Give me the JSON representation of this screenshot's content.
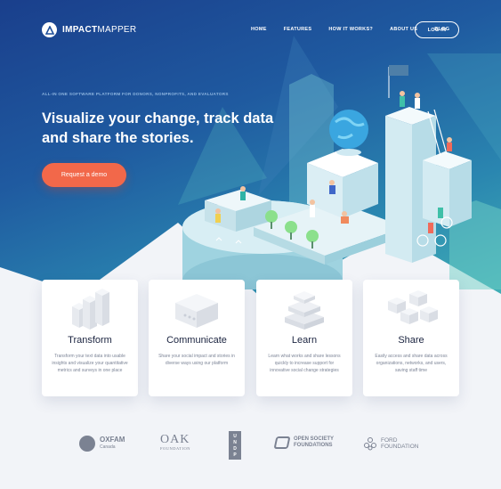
{
  "brand": {
    "name_bold": "IMPACT",
    "name_light": "MAPPER"
  },
  "nav": {
    "items": [
      "HOME",
      "FEATURES",
      "HOW IT WORKS?",
      "ABOUT US",
      "BLOG"
    ],
    "login": "LOG IN"
  },
  "hero": {
    "tagline": "ALL-IN ONE SOFTWARE PLATFORM FOR DONORS, NONPROFITS, AND EVALUATORS",
    "headline": "Visualize your change, track data and share the stories.",
    "cta": "Request a demo"
  },
  "features": [
    {
      "title": "Transform",
      "text": "Transform your text data into usable insights and visualize your quantitative metrics and surveys in one place"
    },
    {
      "title": "Communicate",
      "text": "Share your social impact and stories in diverse ways using our platform"
    },
    {
      "title": "Learn",
      "text": "Learn what works and share lessons quickly to increase support for innovative social change strategies"
    },
    {
      "title": "Share",
      "text": "Easily access and share data across organizations, networks, and users, saving staff time"
    }
  ],
  "partners": {
    "oxfam": {
      "name": "OXFAM",
      "sub": "Canada"
    },
    "oak": {
      "name": "OAK",
      "sub": "FOUNDATION"
    },
    "undp": {
      "letters": [
        "U",
        "N",
        "D",
        "P"
      ]
    },
    "osf": {
      "line1": "OPEN SOCIETY",
      "line2": "FOUNDATIONS"
    },
    "ford": {
      "line1": "FORD",
      "line2": "FOUNDATION"
    }
  },
  "colors": {
    "accent": "#f2684a",
    "hero_start": "#1a3f8c",
    "hero_end": "#49c2b8",
    "text_dark": "#1b2440"
  }
}
